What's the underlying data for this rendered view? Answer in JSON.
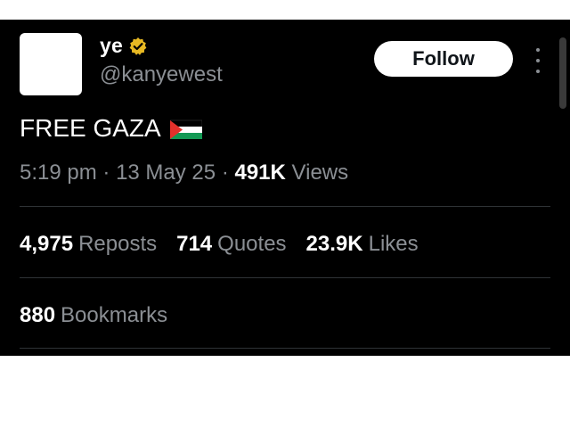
{
  "tweet": {
    "author": {
      "display_name": "ye",
      "handle": "@kanyewest",
      "verified_icon": "verified-badge-icon",
      "verified_color": "#e8b923"
    },
    "follow_label": "Follow",
    "more_icon": "more-vertical-icon",
    "text": "FREE GAZA",
    "flag_icon": "palestine-flag-icon",
    "meta": {
      "time": "5:19 pm",
      "separator": "·",
      "date": "13 May 25",
      "views_count": "491K",
      "views_label": "Views"
    },
    "stats": [
      {
        "count": "4,975",
        "label": "Reposts"
      },
      {
        "count": "714",
        "label": "Quotes"
      },
      {
        "count": "23.9K",
        "label": "Likes"
      }
    ],
    "bookmarks": {
      "count": "880",
      "label": "Bookmarks"
    }
  },
  "colors": {
    "background": "#000000",
    "text_primary": "#ffffff",
    "text_secondary": "#8b8f94",
    "divider": "#2f3336",
    "follow_bg": "#ffffff"
  }
}
